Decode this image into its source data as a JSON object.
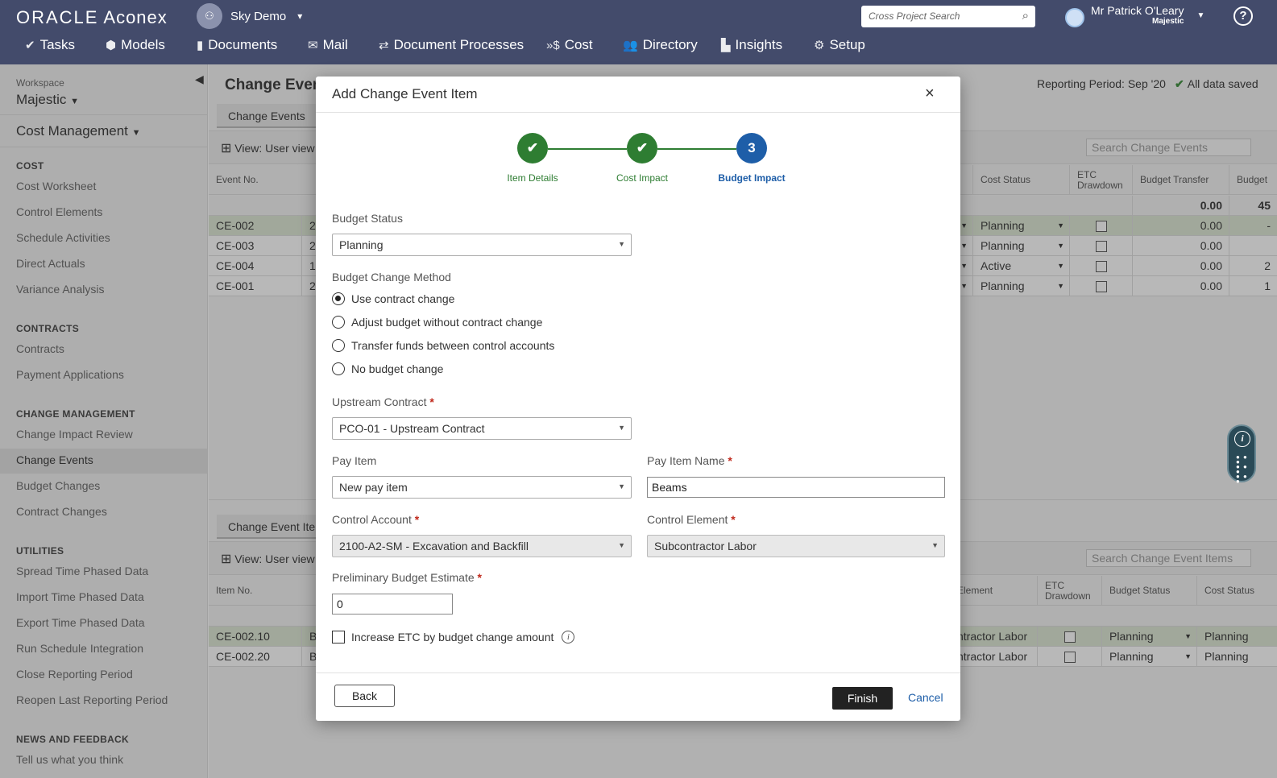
{
  "header": {
    "logo_oracle": "ORACLE",
    "logo_product": "Aconex",
    "project": "Sky Demo",
    "search_placeholder": "Cross Project Search",
    "user_name": "Mr Patrick O'Leary",
    "user_org": "Majestic",
    "help": "?"
  },
  "nav": [
    {
      "label": "Tasks",
      "icon": "check-icon"
    },
    {
      "label": "Models",
      "icon": "cube-icon"
    },
    {
      "label": "Documents",
      "icon": "document-icon"
    },
    {
      "label": "Mail",
      "icon": "mail-icon"
    },
    {
      "label": "Document Processes",
      "icon": "workflow-icon"
    },
    {
      "label": "Cost",
      "icon": "cost-icon"
    },
    {
      "label": "Directory",
      "icon": "people-icon"
    },
    {
      "label": "Insights",
      "icon": "bar-chart-icon"
    },
    {
      "label": "Setup",
      "icon": "gear-icon"
    }
  ],
  "sidebar": {
    "workspace_label": "Workspace",
    "workspace_value": "Majestic",
    "module": "Cost Management",
    "sections": [
      {
        "title": "COST",
        "items": [
          "Cost Worksheet",
          "Control Elements",
          "Schedule Activities",
          "Direct Actuals",
          "Variance Analysis"
        ]
      },
      {
        "title": "CONTRACTS",
        "items": [
          "Contracts",
          "Payment Applications"
        ]
      },
      {
        "title": "CHANGE MANAGEMENT",
        "items": [
          "Change Impact Review",
          "Change Events",
          "Budget Changes",
          "Contract Changes"
        ]
      },
      {
        "title": "UTILITIES",
        "items": [
          "Spread Time Phased Data",
          "Import Time Phased Data",
          "Export Time Phased Data",
          "Run Schedule Integration",
          "Close Reporting Period",
          "Reopen Last Reporting Period"
        ]
      },
      {
        "title": "NEWS AND FEEDBACK",
        "items": [
          "Tell us what you think"
        ]
      }
    ],
    "active_item": "Change Events"
  },
  "main": {
    "title": "Change Events",
    "reporting_period": "Reporting Period: Sep '20",
    "saved": "All data saved",
    "top_tab": "Change Events",
    "view_label": "View: User view",
    "search_events": "Search Change Events",
    "events_columns": [
      "Event No.",
      "Cost Status",
      "ETC Drawdown",
      "Budget Transfer",
      "Budget"
    ],
    "events_total": {
      "budget_transfer": "0.00",
      "budget": "45"
    },
    "events": [
      {
        "no": "CE-002",
        "col2": "2",
        "cost_status": "Planning",
        "budget_transfer": "0.00",
        "budget": "-"
      },
      {
        "no": "CE-003",
        "col2": "2",
        "cost_status": "Planning",
        "budget_transfer": "0.00",
        "budget": ""
      },
      {
        "no": "CE-004",
        "col2": "1",
        "cost_status": "Active",
        "budget_transfer": "0.00",
        "budget": "2"
      },
      {
        "no": "CE-001",
        "col2": "2",
        "cost_status": "Planning",
        "budget_transfer": "0.00",
        "budget": "1"
      }
    ],
    "bottom_tab": "Change Event Items",
    "search_items": "Search Change Event Items",
    "items_columns": [
      "Item No.",
      "Element",
      "ETC Drawdown",
      "Budget Status",
      "Cost Status"
    ],
    "items": [
      {
        "no": "CE-002.10",
        "col2": "B",
        "element": "ntractor Labor",
        "budget_status": "Planning",
        "cost_status": "Planning"
      },
      {
        "no": "CE-002.20",
        "col2": "B",
        "element": "ntractor Labor",
        "budget_status": "Planning",
        "cost_status": "Planning"
      }
    ]
  },
  "dialog": {
    "title": "Add Change Event Item",
    "close": "×",
    "steps": [
      {
        "label": "Item Details",
        "state": "done"
      },
      {
        "label": "Cost Impact",
        "state": "done"
      },
      {
        "label": "Budget Impact",
        "state": "current",
        "number": "3"
      }
    ],
    "budget_status_label": "Budget Status",
    "budget_status_value": "Planning",
    "method_label": "Budget Change Method",
    "methods": [
      {
        "label": "Use contract change",
        "selected": true
      },
      {
        "label": "Adjust budget without contract change",
        "selected": false
      },
      {
        "label": "Transfer funds between control accounts",
        "selected": false
      },
      {
        "label": "No budget change",
        "selected": false
      }
    ],
    "upstream_label": "Upstream Contract",
    "upstream_value": "PCO-01 - Upstream Contract",
    "pay_item_label": "Pay Item",
    "pay_item_value": "New pay item",
    "pay_item_name_label": "Pay Item Name",
    "pay_item_name_value": "Beams",
    "control_account_label": "Control Account",
    "control_account_value": "2100-A2-SM - Excavation and Backfill",
    "control_element_label": "Control Element",
    "control_element_value": "Subcontractor Labor",
    "prelim_label": "Preliminary Budget Estimate",
    "prelim_value": "0",
    "increase_etc_label": "Increase ETC by budget change amount",
    "back": "Back",
    "finish": "Finish",
    "cancel": "Cancel"
  },
  "colors": {
    "header": "#434b6b",
    "done": "#2e7d32",
    "current": "#1e5ea8",
    "required": "#c0281b"
  }
}
